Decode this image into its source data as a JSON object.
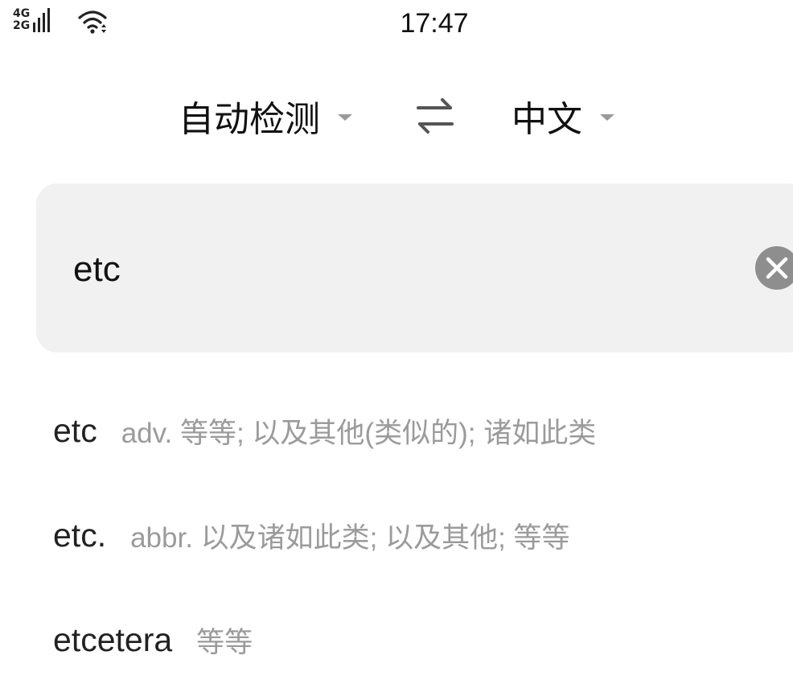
{
  "status_bar": {
    "network_top": "4G",
    "network_bottom": "2G",
    "time": "17:47",
    "signal_icon": "cell-signal-icon",
    "wifi_icon": "wifi-icon"
  },
  "language_bar": {
    "source_language": "自动检测",
    "target_language": "中文",
    "swap_icon": "swap-arrows-icon"
  },
  "input": {
    "value": "etc",
    "clear_icon": "clear-icon"
  },
  "suggestions": [
    {
      "word": "etc",
      "definition": "adv. 等等; 以及其他(类似的); 诸如此类"
    },
    {
      "word": "etc.",
      "definition": "abbr. 以及诸如此类; 以及其他; 等等"
    },
    {
      "word": "etcetera",
      "definition": "等等"
    }
  ],
  "colors": {
    "card_background": "#f1f1f1",
    "secondary_text": "#9b9b9b",
    "clear_button": "#8e8e8e"
  }
}
